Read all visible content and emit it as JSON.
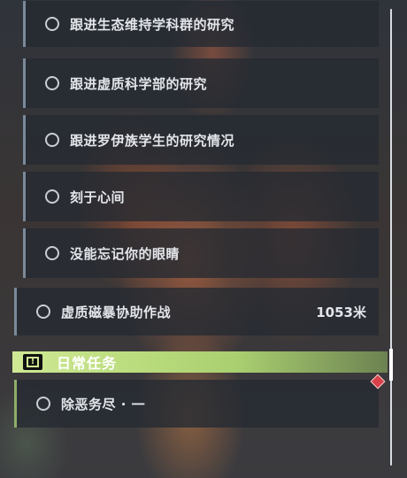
{
  "quest_list": {
    "items": [
      {
        "label": "跟进生态维持学科群的研究"
      },
      {
        "label": "跟进虚质科学部的研究"
      },
      {
        "label": "跟进罗伊族学生的研究情况"
      },
      {
        "label": "刻于心间"
      },
      {
        "label": "没能忘记你的眼睛"
      },
      {
        "label": "虚质磁暴协助作战",
        "distance": "1053米"
      }
    ]
  },
  "daily": {
    "title": "日常任务",
    "items": [
      {
        "label": "除恶务尽 · 一"
      }
    ]
  },
  "colors": {
    "accent_green": "#b9db7c",
    "marker_red": "#d9404a",
    "quest_bar": "#7b8a9a"
  }
}
